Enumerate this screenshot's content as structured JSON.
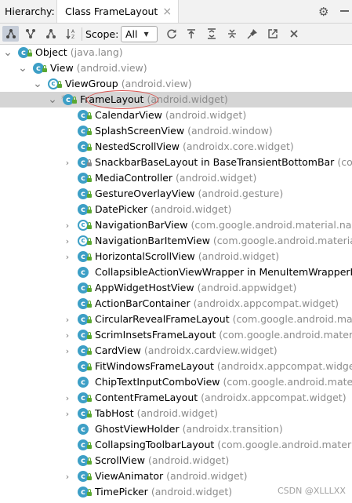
{
  "header": {
    "label": "Hierarchy:",
    "tab_label": "Class FrameLayout",
    "tab_close_glyph": "×",
    "settings_icon": "gear-icon",
    "minimize_icon": "minimize-icon"
  },
  "toolbar": {
    "scope_label": "Scope:",
    "scope_value": "All",
    "icons": [
      "class-hierarchy-icon",
      "supertypes-icon",
      "subtypes-icon",
      "sort-alpha-icon",
      "refresh-icon",
      "export-icon",
      "expand-all-icon",
      "collapse-all-icon",
      "pin-icon",
      "open-in-editor-icon",
      "close-icon"
    ]
  },
  "tree": {
    "rows": [
      {
        "name": "Object",
        "pkg": "(java.lang)",
        "arrow": "down",
        "icon": "class"
      },
      {
        "name": "View",
        "pkg": "(android.view)",
        "arrow": "down",
        "icon": "class"
      },
      {
        "name": "ViewGroup",
        "pkg": "(android.view)",
        "arrow": "down",
        "icon": "abstract"
      },
      {
        "name": "FrameLayout",
        "pkg": "(android.widget)",
        "arrow": "down",
        "icon": "class",
        "selected": true
      },
      {
        "name": "CalendarView",
        "pkg": "(android.widget)",
        "arrow": "",
        "icon": "class"
      },
      {
        "name": "SplashScreenView",
        "pkg": "(android.window)",
        "arrow": "",
        "icon": "class"
      },
      {
        "name": "NestedScrollView",
        "pkg": "(androidx.core.widget)",
        "arrow": "",
        "icon": "class"
      },
      {
        "name": "SnackbarBaseLayout in BaseTransientBottomBar",
        "pkg": "(com.",
        "arrow": "right",
        "icon": "class",
        "lock": "pkg"
      },
      {
        "name": "MediaController",
        "pkg": "(android.widget)",
        "arrow": "",
        "icon": "class"
      },
      {
        "name": "GestureOverlayView",
        "pkg": "(android.gesture)",
        "arrow": "",
        "icon": "class"
      },
      {
        "name": "DatePicker",
        "pkg": "(android.widget)",
        "arrow": "",
        "icon": "class"
      },
      {
        "name": "NavigationBarView",
        "pkg": "(com.google.android.material.navig",
        "arrow": "right",
        "icon": "abstract"
      },
      {
        "name": "NavigationBarItemView",
        "pkg": "(com.google.android.material.n",
        "arrow": "right",
        "icon": "abstract"
      },
      {
        "name": "HorizontalScrollView",
        "pkg": "(android.widget)",
        "arrow": "right",
        "icon": "class"
      },
      {
        "name": "CollapsibleActionViewWrapper in MenuItemWrapperIC",
        "pkg": "",
        "arrow": "",
        "icon": "class",
        "lock": "none"
      },
      {
        "name": "AppWidgetHostView",
        "pkg": "(android.appwidget)",
        "arrow": "",
        "icon": "class"
      },
      {
        "name": "ActionBarContainer",
        "pkg": "(androidx.appcompat.widget)",
        "arrow": "",
        "icon": "class"
      },
      {
        "name": "CircularRevealFrameLayout",
        "pkg": "(com.google.android.mater",
        "arrow": "right",
        "icon": "class"
      },
      {
        "name": "ScrimInsetsFrameLayout",
        "pkg": "(com.google.android.materia",
        "arrow": "right",
        "icon": "class"
      },
      {
        "name": "CardView",
        "pkg": "(androidx.cardview.widget)",
        "arrow": "right",
        "icon": "class"
      },
      {
        "name": "FitWindowsFrameLayout",
        "pkg": "(androidx.appcompat.widget)",
        "arrow": "",
        "icon": "class"
      },
      {
        "name": "ChipTextInputComboView",
        "pkg": "(com.google.android.materia",
        "arrow": "",
        "icon": "class",
        "lock": "none"
      },
      {
        "name": "ContentFrameLayout",
        "pkg": "(androidx.appcompat.widget)",
        "arrow": "right",
        "icon": "class"
      },
      {
        "name": "TabHost",
        "pkg": "(android.widget)",
        "arrow": "right",
        "icon": "class"
      },
      {
        "name": "GhostViewHolder",
        "pkg": "(androidx.transition)",
        "arrow": "",
        "icon": "class",
        "lock": "none"
      },
      {
        "name": "CollapsingToolbarLayout",
        "pkg": "(com.google.android.materia",
        "arrow": "",
        "icon": "class"
      },
      {
        "name": "ScrollView",
        "pkg": "(android.widget)",
        "arrow": "",
        "icon": "class"
      },
      {
        "name": "ViewAnimator",
        "pkg": "(android.widget)",
        "arrow": "right",
        "icon": "class"
      },
      {
        "name": "TimePicker",
        "pkg": "(android.widget)",
        "arrow": "",
        "icon": "class"
      }
    ]
  },
  "watermark": "CSDN @XLLLXX",
  "colors": {
    "class_icon": "#3d9fc6",
    "public_lock": "#5aa832",
    "annotation_circle": "#d9534f",
    "selection": "#d5d5d5"
  }
}
